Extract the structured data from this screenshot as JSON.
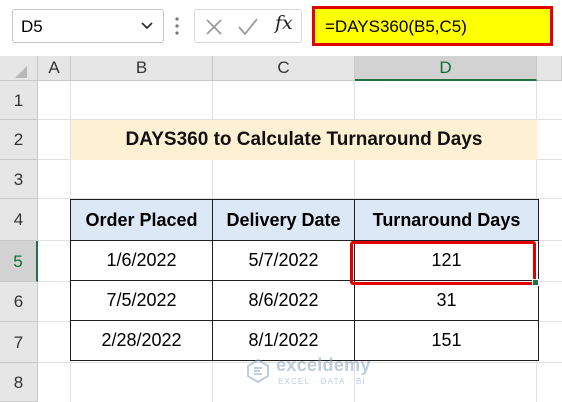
{
  "formula_bar": {
    "name_box": "D5",
    "fx_label": "fx",
    "formula": "=DAYS360(B5,C5)"
  },
  "columns": [
    "A",
    "B",
    "C",
    "D"
  ],
  "selected_column": "D",
  "rows": [
    "1",
    "2",
    "3",
    "4",
    "5",
    "6",
    "7",
    "8"
  ],
  "selected_row": "5",
  "sheet": {
    "title": "DAYS360 to Calculate Turnaround Days",
    "headers": [
      "Order Placed",
      "Delivery Date",
      "Turnaround Days"
    ],
    "records": [
      [
        "1/6/2022",
        "5/7/2022",
        "121"
      ],
      [
        "7/5/2022",
        "8/6/2022",
        "31"
      ],
      [
        "2/28/2022",
        "8/1/2022",
        "151"
      ]
    ]
  },
  "watermark": {
    "name": "exceldemy",
    "tagline": "EXCEL · DATA · BI"
  },
  "colors": {
    "highlight_red": "#e00000",
    "formula_fill": "#ffff00",
    "title_fill": "#fdf0d3",
    "header_fill": "#dde8f7",
    "excel_green": "#217346"
  }
}
